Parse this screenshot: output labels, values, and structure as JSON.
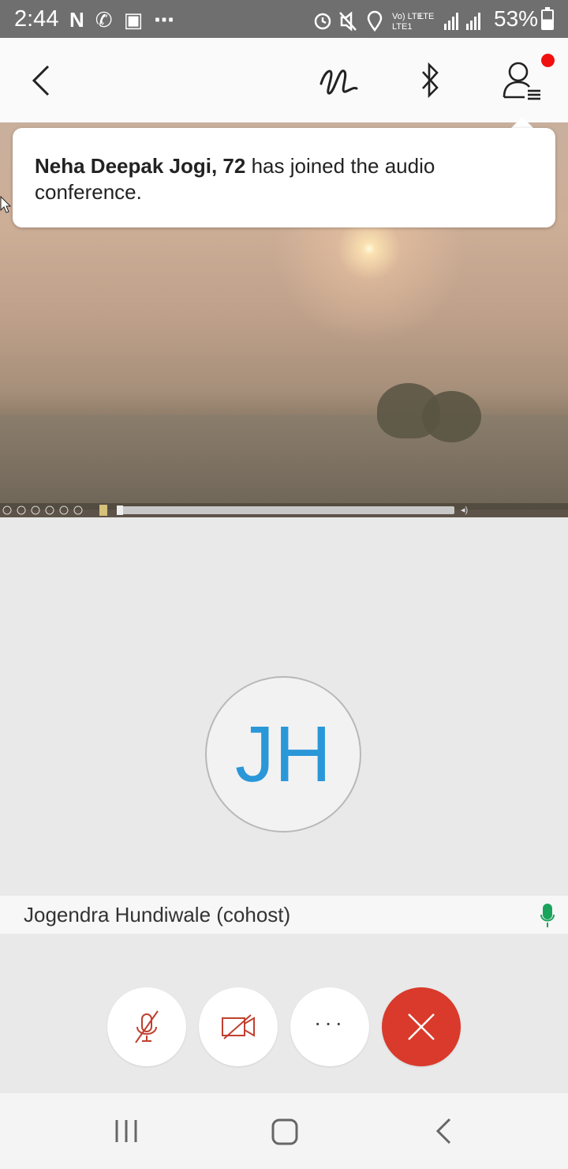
{
  "status_bar": {
    "time": "2:44",
    "left_icons": [
      "n-icon",
      "phone-icon",
      "gallery-icon",
      "more-dots-icon"
    ],
    "right_icons": [
      "alarm-icon",
      "mute-icon",
      "location-icon",
      "volte-lte-icon",
      "signal-icon",
      "signal-icon"
    ],
    "volte_text": "Vo) LTE",
    "lte_text": "LTE",
    "battery_pct": "53%"
  },
  "toolbar": {
    "back_icon": "chevron-left-icon",
    "annotate_icon": "scribble-icon",
    "bluetooth_icon": "bluetooth-icon",
    "participants_icon": "participants-icon",
    "notification_dot_color": "#f01010"
  },
  "toast": {
    "name": "Neha Deepak Jogi, 72",
    "message": " has joined the audio conference."
  },
  "participant": {
    "initials": "JH",
    "name": "Jogendra Hundiwale (cohost)",
    "initials_color": "#2a97d8",
    "mic_color": "#1aa35b"
  },
  "controls": {
    "mute_icon": "mic-muted-icon",
    "video_icon": "video-off-icon",
    "more_label": "···",
    "end_icon": "close-icon",
    "accent": "#d93a2b"
  },
  "nav": {
    "recents_icon": "recents-icon",
    "home_icon": "home-icon",
    "back_icon": "back-icon"
  }
}
